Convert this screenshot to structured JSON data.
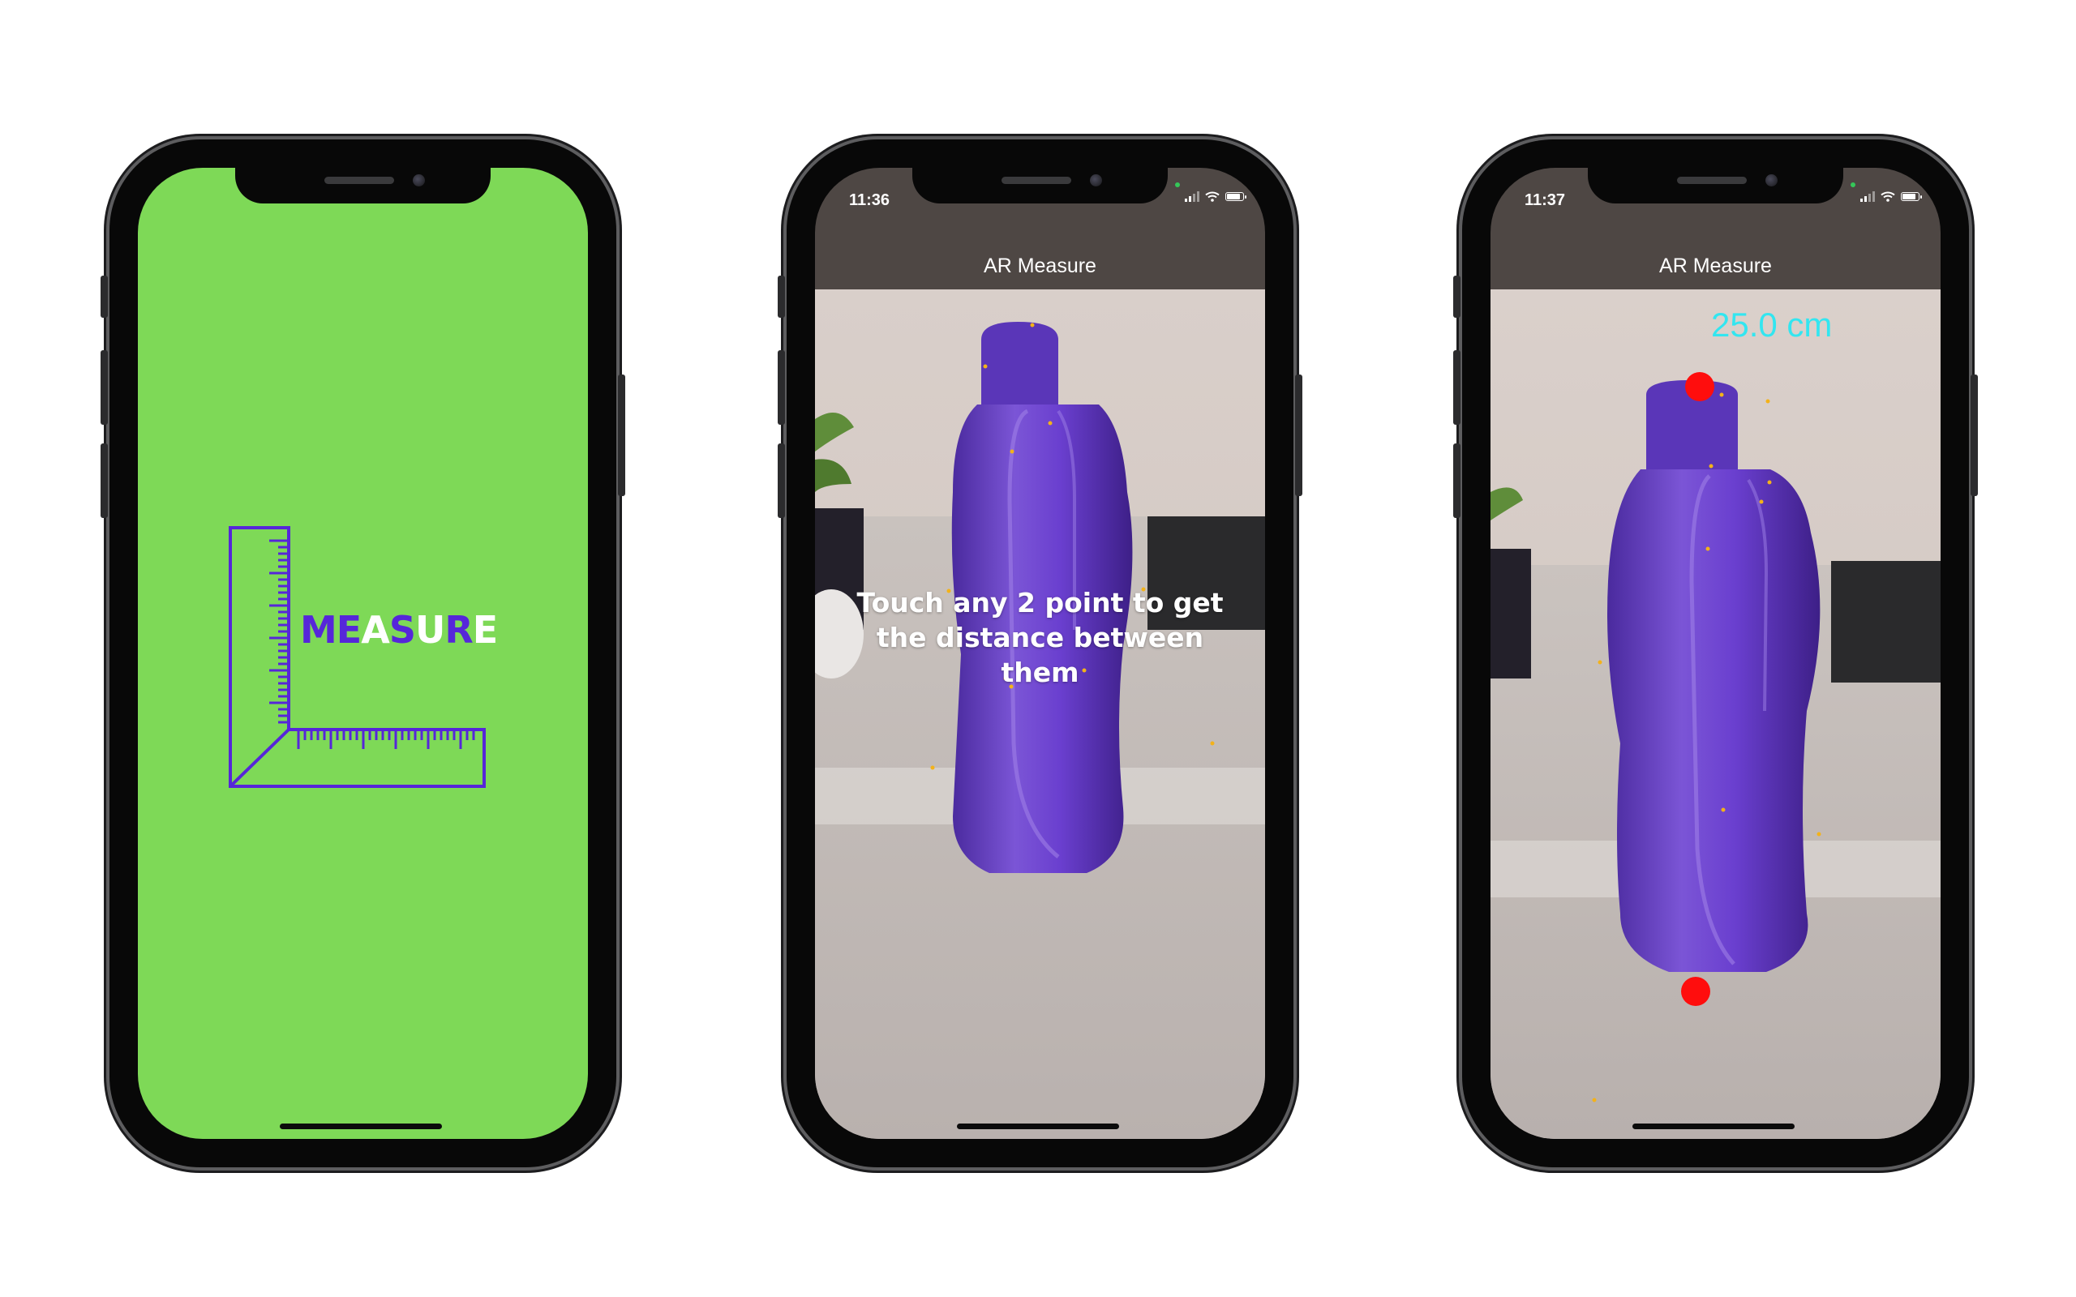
{
  "splash": {
    "logo_word_letters": [
      {
        "ch": "M",
        "color": "purple"
      },
      {
        "ch": "E",
        "color": "purple"
      },
      {
        "ch": "A",
        "color": "white"
      },
      {
        "ch": "S",
        "color": "purple"
      },
      {
        "ch": "U",
        "color": "white"
      },
      {
        "ch": "R",
        "color": "purple"
      },
      {
        "ch": "E",
        "color": "white"
      }
    ],
    "background_color": "#7ed957",
    "logo_color": "#5626d9"
  },
  "screen_instruction": {
    "status": {
      "time": "11:36"
    },
    "nav_title": "AR Measure",
    "overlay_message": "Touch any 2 point to get the distance between them"
  },
  "screen_measurement": {
    "status": {
      "time": "11:37"
    },
    "nav_title": "AR Measure",
    "distance_label": "25.0 cm",
    "point_color": "#ff0d0d",
    "label_color": "#32e6f0"
  },
  "icons": [
    "signal-icon",
    "wifi-icon",
    "battery-icon"
  ]
}
